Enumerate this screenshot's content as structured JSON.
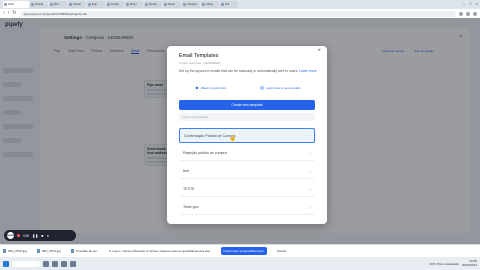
{
  "browser": {
    "tabs": [
      {
        "label": "Settin"
      },
      {
        "label": "Templat"
      },
      {
        "label": "Mod"
      },
      {
        "label": "Ofertas"
      },
      {
        "label": "Esqu"
      },
      {
        "label": "Configu"
      },
      {
        "label": "Mover"
      },
      {
        "label": "(Email)"
      },
      {
        "label": "Pipedri"
      },
      {
        "label": "Compras"
      },
      {
        "label": "Library"
      },
      {
        "label": "Sell"
      }
    ],
    "url": "app.pipefy.com/pipes/302705883/settings/email"
  },
  "app": {
    "logo": "pipefy"
  },
  "settings": {
    "title_prefix": "Settings",
    "title_sep": " - ",
    "title_rest": "Compras - LEONARDO",
    "tabs": [
      "Pipe",
      "Start Form",
      "Phases",
      "Members",
      "Email",
      "Permissions"
    ],
    "right_links": [
      "Adicionar campo",
      "Sair da sessão"
    ],
    "card1_title": "Pipe email",
    "card2_title": "Send emails from address"
  },
  "modal": {
    "title": "Email Templates",
    "subtitle": "In pipe Compras - LEONARDO",
    "description": "Set up the layout for emails that can be manually or automatically sent to users.",
    "learn_more": "Learn more",
    "link_a": "Watch a quick intro",
    "link_b": "Learn how to send emails",
    "create_button": "Create new template",
    "search_placeholder": "Find email template",
    "templates": [
      {
        "name": "Confirmação Pedido de Compra"
      },
      {
        "name": "Rejeição pedido de compra"
      },
      {
        "name": "teet"
      },
      {
        "name": "TESTE"
      },
      {
        "name": "Teste geo"
      }
    ]
  },
  "recorder": {
    "logo": "loom",
    "time": "0:00"
  },
  "downloads": {
    "items": [
      "IMG_0576.jpg",
      "IMG_0574.jpg",
      "Template de sty..."
    ],
    "message": "O Loom + Screen Recorder & Screen Capture está compartilhando sua tela.",
    "stop_button": "Interromper compartilhamento",
    "hide": "Ocultar"
  },
  "taskbar": {
    "weather": "29°C Parc ensolarado",
    "time": "10:55",
    "date": "30/05/2023"
  },
  "colors": {
    "accent": "#2563eb",
    "selected_row_bg": "#eef4ff"
  }
}
